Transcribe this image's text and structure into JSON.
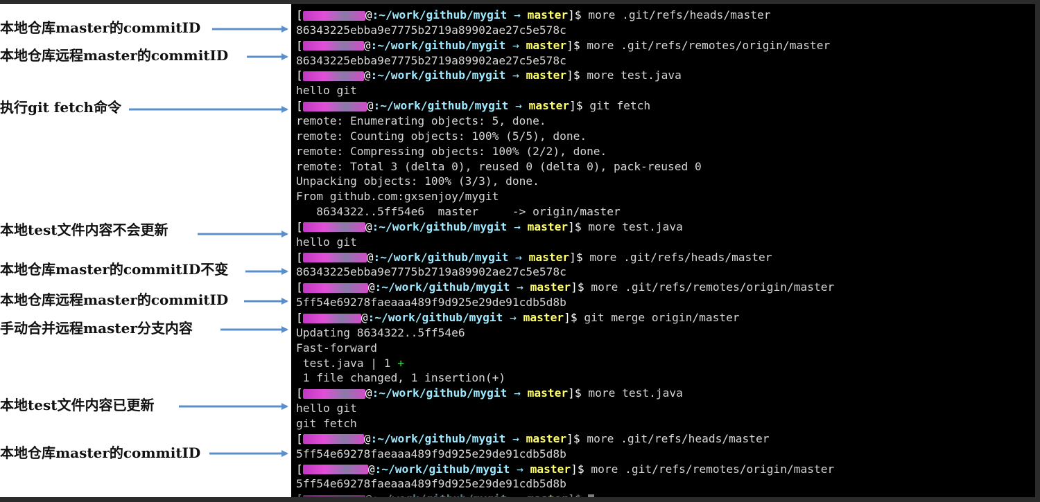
{
  "redacted_user_label": "[g...@",
  "prompt": {
    "path": ":~/work/github/mygit",
    "arrow": "→",
    "branch": "master",
    "end": "]$"
  },
  "terminal_lines": [
    {
      "type": "prompt",
      "cmd": "more .git/refs/heads/master"
    },
    {
      "type": "out",
      "text": "86343225ebba9e7775b2719a89902ae27c5e578c"
    },
    {
      "type": "prompt",
      "cmd": "more .git/refs/remotes/origin/master"
    },
    {
      "type": "out",
      "text": "86343225ebba9e7775b2719a89902ae27c5e578c"
    },
    {
      "type": "prompt",
      "cmd": "more test.java"
    },
    {
      "type": "out",
      "text": "hello git"
    },
    {
      "type": "prompt",
      "cmd": "git fetch"
    },
    {
      "type": "out",
      "text": "remote: Enumerating objects: 5, done."
    },
    {
      "type": "out",
      "text": "remote: Counting objects: 100% (5/5), done."
    },
    {
      "type": "out",
      "text": "remote: Compressing objects: 100% (2/2), done."
    },
    {
      "type": "out",
      "text": "remote: Total 3 (delta 0), reused 0 (delta 0), pack-reused 0"
    },
    {
      "type": "out",
      "text": "Unpacking objects: 100% (3/3), done."
    },
    {
      "type": "out",
      "text": "From github.com:gxsenjoy/mygit"
    },
    {
      "type": "out",
      "text": "   8634322..5ff54e6  master     -> origin/master"
    },
    {
      "type": "prompt",
      "cmd": "more test.java"
    },
    {
      "type": "out",
      "text": "hello git"
    },
    {
      "type": "prompt",
      "cmd": "more .git/refs/heads/master"
    },
    {
      "type": "out",
      "text": "86343225ebba9e7775b2719a89902ae27c5e578c"
    },
    {
      "type": "prompt",
      "cmd": "more .git/refs/remotes/origin/master"
    },
    {
      "type": "out",
      "text": "5ff54e69278faeaaa489f9d925e29de91cdb5d8b"
    },
    {
      "type": "prompt",
      "cmd": "git merge origin/master"
    },
    {
      "type": "out",
      "text": "Updating 8634322..5ff54e6"
    },
    {
      "type": "out",
      "text": "Fast-forward"
    },
    {
      "type": "diff",
      "text": " test.java | 1 ",
      "plus": "+"
    },
    {
      "type": "out",
      "text": " 1 file changed, 1 insertion(+)"
    },
    {
      "type": "prompt",
      "cmd": "more test.java"
    },
    {
      "type": "out",
      "text": "hello git"
    },
    {
      "type": "out",
      "text": "git fetch"
    },
    {
      "type": "prompt",
      "cmd": "more .git/refs/heads/master"
    },
    {
      "type": "out",
      "text": "5ff54e69278faeaaa489f9d925e29de91cdb5d8b"
    },
    {
      "type": "prompt",
      "cmd": "more .git/refs/remotes/origin/master"
    },
    {
      "type": "out",
      "text": "5ff54e69278faeaaa489f9d925e29de91cdb5d8b"
    },
    {
      "type": "cursor",
      "cmd": ""
    }
  ],
  "annotations": [
    "本地仓库master的commitID",
    "本地仓库远程master的commitID",
    "执行git fetch命令",
    "本地test文件内容不会更新",
    "本地仓库master的commitID不变",
    "本地仓库远程master的commitID",
    "手动合并远程master分支内容",
    "本地test文件内容已更新",
    "本地仓库master的commitID"
  ],
  "colors": {
    "arrow": "#5b8fc9",
    "terminal_bg": "#000000",
    "path": "#9ee9ff",
    "branch": "#ffff66",
    "plus": "#3cdc3c"
  }
}
